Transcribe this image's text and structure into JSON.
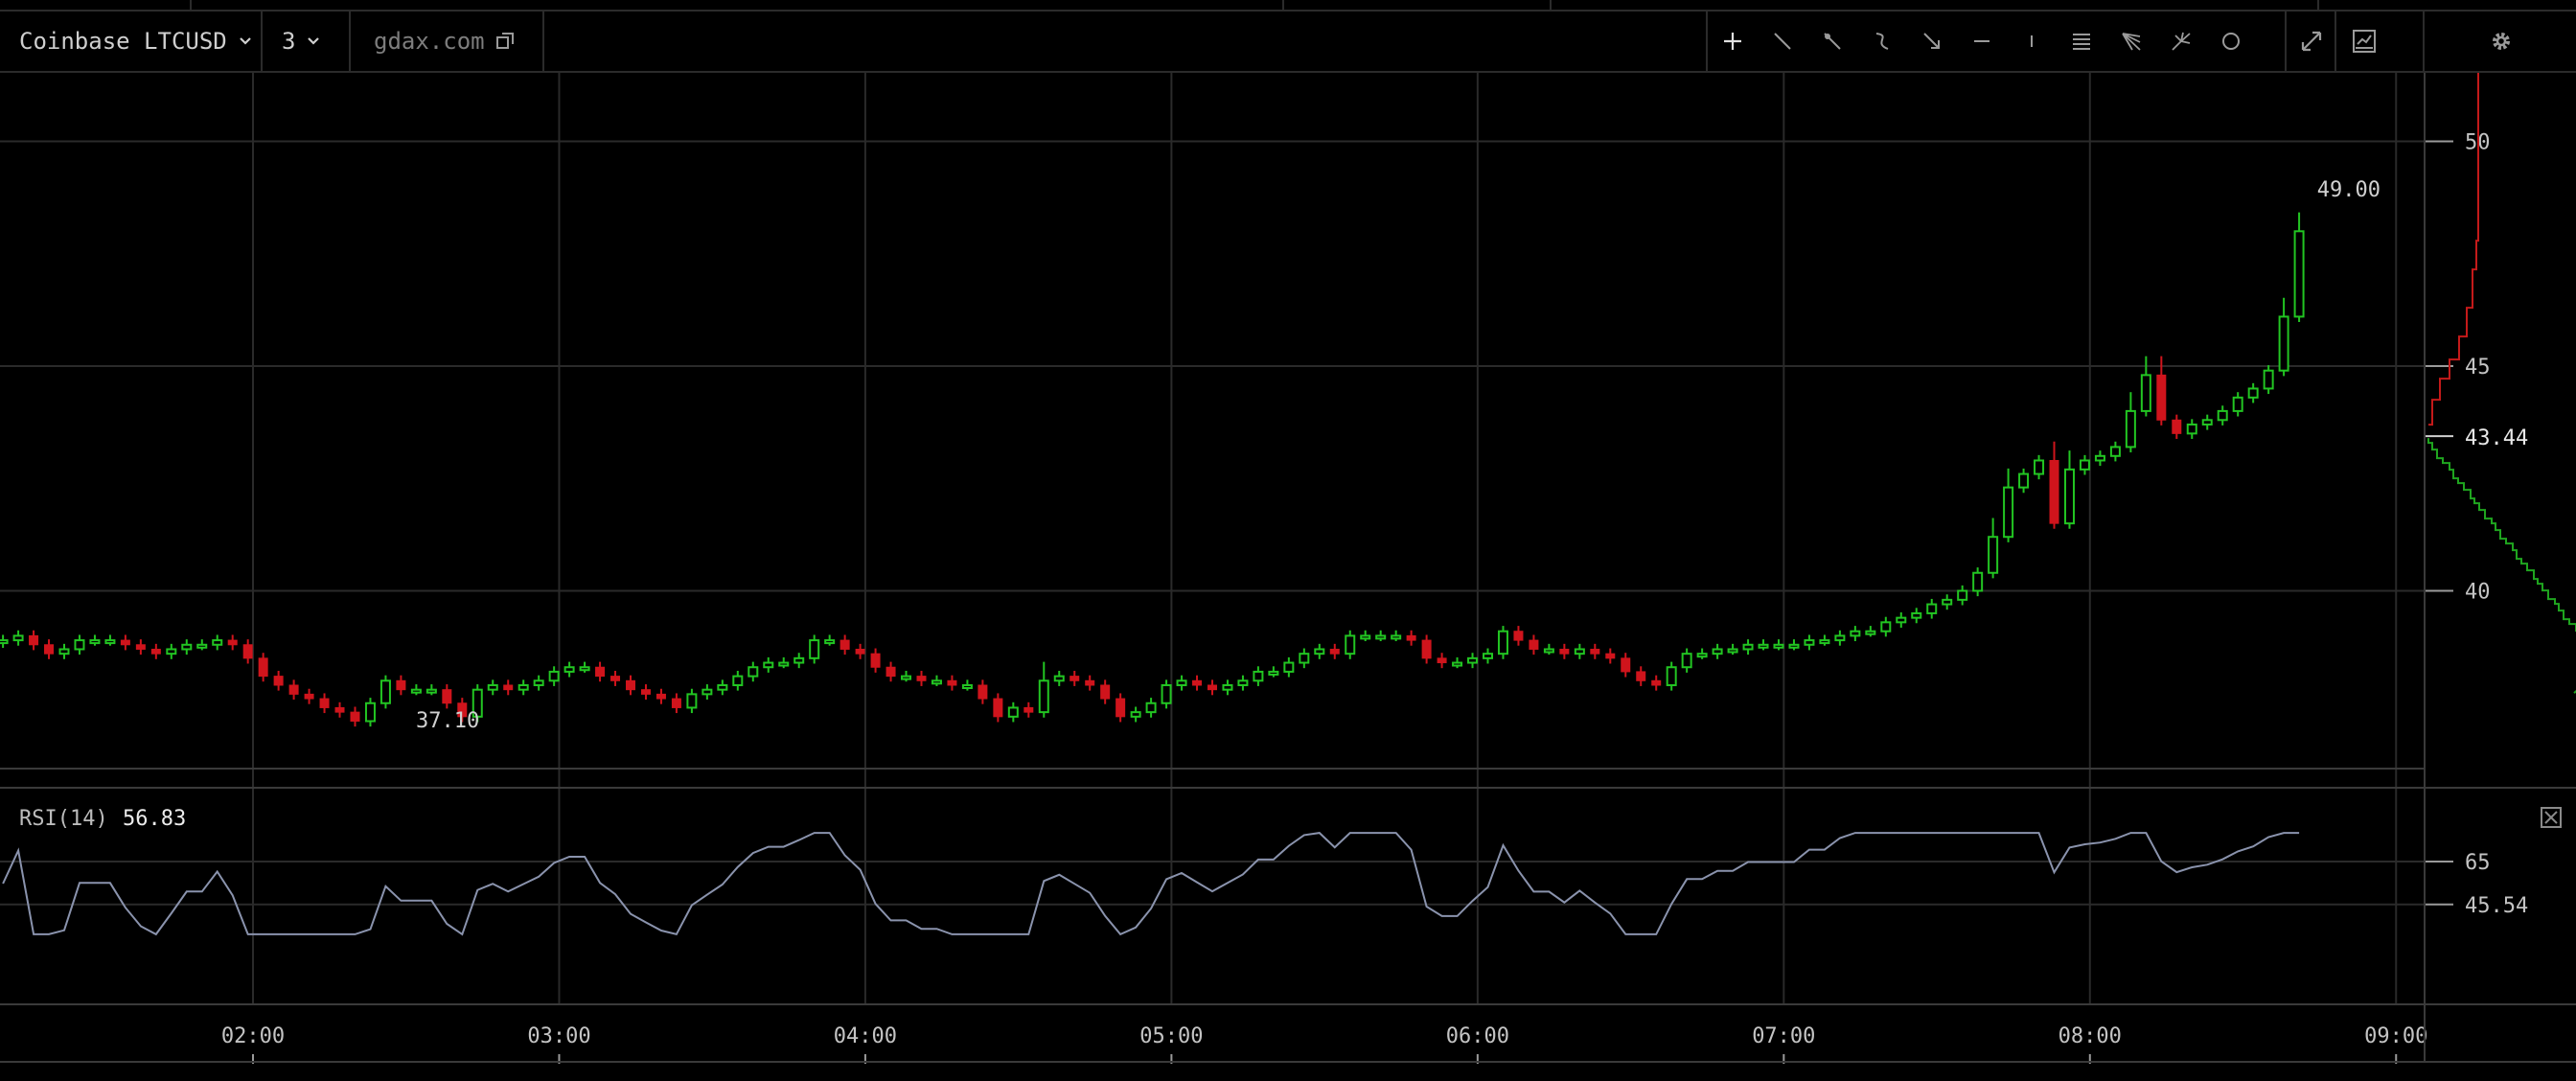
{
  "toolbar": {
    "symbol": "Coinbase LTCUSD",
    "interval": "3",
    "source": "gdax.com",
    "tools": [
      "crosshair-icon",
      "trend-line-icon",
      "ray-icon",
      "curve-icon",
      "arrow-icon",
      "horizontal-line-icon",
      "vertical-line-icon",
      "parallel-lines-icon",
      "fib-fan-icon",
      "pitchfork-icon",
      "circle-icon"
    ],
    "fullscreen_icon": "fullscreen-icon",
    "snapshot_icon": "chart-snapshot-icon",
    "settings_icon": "gear-icon"
  },
  "indicator": {
    "label": "RSI(14)",
    "value": "56.83"
  },
  "colors": {
    "up": "#22c522",
    "down": "#d0141c",
    "grid": "#2a2a2a",
    "rsi": "#8a93ad",
    "book_bid": "#1fa51f",
    "book_ask": "#c41a1a"
  },
  "chart_data": {
    "type": "candlestick",
    "price_ylim": [
      36.5,
      51.3
    ],
    "price_ticks": [
      "40",
      "45",
      "50"
    ],
    "last_price_label": "43.44",
    "high_label": "49.00",
    "low_label": "37.10",
    "rsi_ylim": [
      20,
      85
    ],
    "rsi_ticks": [
      "65",
      "45.54"
    ],
    "x_ticks": [
      "02:00",
      "03:00",
      "04:00",
      "05:00",
      "06:00",
      "07:00",
      "08:00",
      "09:00"
    ],
    "x_tick_minutes": [
      120,
      180,
      240,
      300,
      360,
      420,
      480,
      540
    ],
    "start_minute": 71,
    "bar_minutes": 3,
    "close": [
      38.9,
      39.0,
      38.8,
      38.6,
      38.7,
      38.9,
      38.9,
      38.9,
      38.8,
      38.7,
      38.6,
      38.7,
      38.8,
      38.8,
      38.9,
      38.8,
      38.5,
      38.1,
      37.9,
      37.7,
      37.6,
      37.4,
      37.3,
      37.1,
      37.5,
      38.0,
      37.8,
      37.8,
      37.8,
      37.5,
      37.2,
      37.8,
      37.9,
      37.8,
      37.9,
      38.0,
      38.2,
      38.3,
      38.3,
      38.1,
      38.0,
      37.8,
      37.7,
      37.6,
      37.4,
      37.7,
      37.8,
      37.9,
      38.1,
      38.3,
      38.4,
      38.4,
      38.5,
      38.9,
      38.9,
      38.7,
      38.6,
      38.3,
      38.1,
      38.1,
      38.0,
      38.0,
      37.9,
      37.9,
      37.6,
      37.2,
      37.4,
      37.3,
      38.0,
      38.1,
      38.0,
      37.9,
      37.6,
      37.2,
      37.3,
      37.5,
      37.9,
      38.0,
      37.9,
      37.8,
      37.9,
      38.0,
      38.2,
      38.2,
      38.4,
      38.6,
      38.7,
      38.6,
      39.0,
      39.0,
      39.0,
      39.0,
      38.9,
      38.5,
      38.4,
      38.4,
      38.5,
      38.6,
      39.1,
      38.9,
      38.7,
      38.7,
      38.6,
      38.7,
      38.6,
      38.5,
      38.2,
      38.0,
      37.9,
      38.3,
      38.6,
      38.6,
      38.7,
      38.7,
      38.8,
      38.8,
      38.8,
      38.8,
      38.9,
      38.9,
      39.0,
      39.1,
      39.1,
      39.3,
      39.4,
      39.5,
      39.7,
      39.8,
      40.0,
      40.4,
      41.2,
      42.3,
      42.6,
      42.9,
      41.5,
      42.7,
      42.9,
      43.0,
      43.2,
      44.0,
      44.8,
      43.8,
      43.5,
      43.7,
      43.8,
      44.0,
      44.3,
      44.5,
      44.9,
      46.1,
      48.0
    ]
  }
}
